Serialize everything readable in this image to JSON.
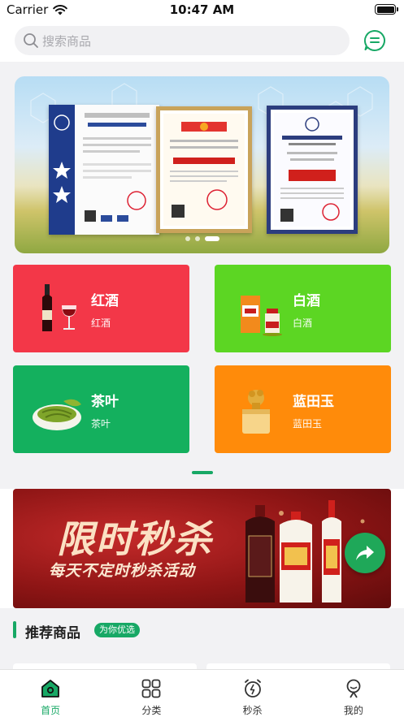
{
  "status": {
    "carrier": "Carrier",
    "time": "10:47 AM"
  },
  "header": {
    "search_placeholder": "搜索商品"
  },
  "banner": {
    "slides": 3,
    "active_slide": 1
  },
  "categories": [
    {
      "name": "红酒",
      "sub": "红酒",
      "color": "#f33748"
    },
    {
      "name": "白酒",
      "sub": "白酒",
      "color": "#5cd623"
    },
    {
      "name": "茶叶",
      "sub": "茶叶",
      "color": "#14b05e"
    },
    {
      "name": "蓝田玉",
      "sub": "蓝田玉",
      "color": "#ff8b0a"
    }
  ],
  "promo": {
    "title": "限时秒杀",
    "subtitle": "每天不定时秒杀活动"
  },
  "recommend": {
    "title": "推荐商品",
    "tag": "为你优选"
  },
  "tabbar": {
    "items": [
      {
        "label": "首页",
        "icon": "home-icon",
        "active": true
      },
      {
        "label": "分类",
        "icon": "category-grid-icon",
        "active": false
      },
      {
        "label": "秒杀",
        "icon": "alarm-clock-icon",
        "active": false
      },
      {
        "label": "我的",
        "icon": "user-icon",
        "active": false
      }
    ]
  },
  "colors": {
    "accent": "#17a865",
    "promo_bg": "#8e1515"
  }
}
